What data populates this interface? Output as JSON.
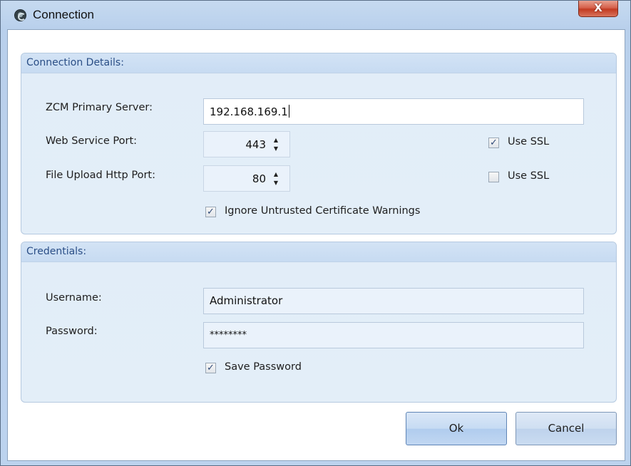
{
  "window": {
    "title": "Connection",
    "close_glyph": "X"
  },
  "details": {
    "header": "Connection Details:",
    "primary_server_label": "ZCM Primary Server:",
    "primary_server_value": "192.168.169.1",
    "web_port_label": "Web Service Port:",
    "web_port_value": "443",
    "upload_port_label": "File Upload Http Port:",
    "upload_port_value": "80",
    "use_ssl_label": "Use SSL",
    "use_ssl_web_checked": true,
    "use_ssl_upload_checked": false,
    "ignore_cert_label": "Ignore Untrusted Certificate Warnings",
    "ignore_cert_checked": true
  },
  "credentials": {
    "header": "Credentials:",
    "username_label": "Username:",
    "username_value": "Administrator",
    "password_label": "Password:",
    "password_value": "********",
    "save_password_label": "Save Password",
    "save_password_checked": true
  },
  "buttons": {
    "ok_label": "Ok",
    "cancel_label": "Cancel"
  },
  "icons": {
    "check": "✓",
    "spin_up": "▲",
    "spin_down": "▼"
  },
  "colors": {
    "group_header_text": "#2a4e86",
    "close_button": "#c23b22"
  }
}
